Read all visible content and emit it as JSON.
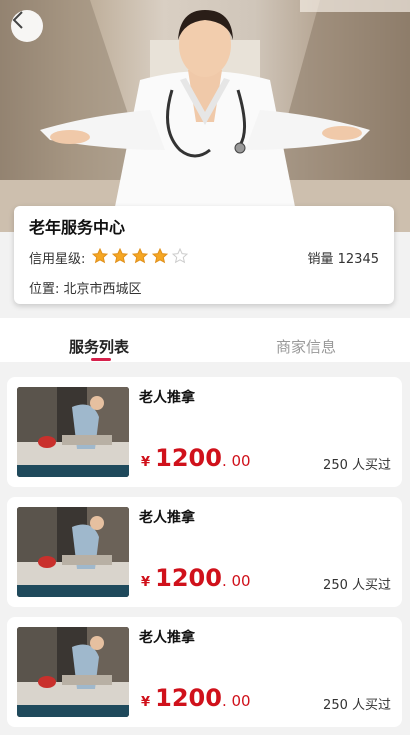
{
  "header": {
    "back_icon": "chevron-left-icon"
  },
  "shop": {
    "name": "老年服务中心",
    "rating_label": "信用星级:",
    "rating": 4,
    "rating_max": 5,
    "sales": "销量 12345",
    "location": "位置: 北京市西城区"
  },
  "tabs": [
    {
      "label": "服务列表",
      "active": true
    },
    {
      "label": "商家信息",
      "active": false
    }
  ],
  "services": [
    {
      "name": "老人推拿",
      "currency": "¥",
      "price_int": "1200",
      "price_dec": ". 00",
      "buyers": "250 人买过"
    },
    {
      "name": "老人推拿",
      "currency": "¥",
      "price_int": "1200",
      "price_dec": ". 00",
      "buyers": "250 人买过"
    },
    {
      "name": "老人推拿",
      "currency": "¥",
      "price_int": "1200",
      "price_dec": ". 00",
      "buyers": "250 人买过"
    }
  ],
  "colors": {
    "accent": "#d6204b",
    "price": "#d0111b",
    "star": "#f5a623",
    "star_empty": "#cccccc"
  }
}
